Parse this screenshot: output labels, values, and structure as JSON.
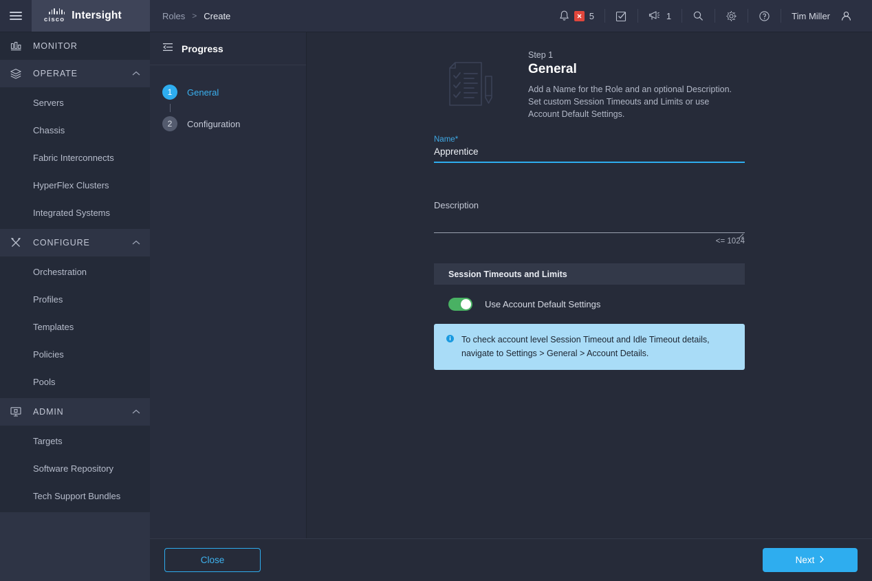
{
  "header": {
    "menu_icon": "hamburger-icon",
    "brand_mark": "cisco-logo",
    "brand_word": "cisco",
    "product": "Intersight",
    "breadcrumb": [
      "Roles",
      "Create"
    ],
    "breadcrumb_separator": ">",
    "alarm_count": "5",
    "announcement_count": "1",
    "user": "Tim Miller",
    "icons": [
      "bell-icon",
      "alarm-badge-icon",
      "task-check-icon",
      "megaphone-icon",
      "search-icon",
      "gear-icon",
      "help-icon",
      "user-avatar-icon"
    ]
  },
  "sidebar": {
    "groups": [
      {
        "label": "MONITOR",
        "icon": "bar-chart-icon",
        "expandable": false,
        "items": []
      },
      {
        "label": "OPERATE",
        "icon": "layers-icon",
        "expandable": true,
        "items": [
          "Servers",
          "Chassis",
          "Fabric Interconnects",
          "HyperFlex Clusters",
          "Integrated Systems"
        ]
      },
      {
        "label": "CONFIGURE",
        "icon": "tools-icon",
        "expandable": true,
        "items": [
          "Orchestration",
          "Profiles",
          "Templates",
          "Policies",
          "Pools"
        ]
      },
      {
        "label": "ADMIN",
        "icon": "admin-monitor-icon",
        "expandable": true,
        "items": [
          "Targets",
          "Software Repository",
          "Tech Support Bundles"
        ]
      }
    ]
  },
  "progress": {
    "collapse_icon": "collapse-panel-icon",
    "title": "Progress",
    "steps": [
      {
        "number": "1",
        "label": "General",
        "state": "active"
      },
      {
        "number": "2",
        "label": "Configuration",
        "state": "inactive"
      }
    ]
  },
  "main": {
    "illustration": "checklist-document-pencil-icon",
    "eyebrow": "Step 1",
    "title": "General",
    "description": "Add a Name for the Role and an optional Description. Set custom Session Timeouts and Limits or use Account Default Settings.",
    "name_field": {
      "label": "Name",
      "required_marker": "*",
      "value": "Apprentice",
      "placeholder": ""
    },
    "description_field": {
      "label": "Description",
      "value": "",
      "placeholder": "",
      "char_limit": "<= 1024"
    },
    "session_section": {
      "title": "Session Timeouts and Limits",
      "toggle_label": "Use Account Default Settings",
      "toggle_state": "on",
      "info_icon": "info-icon",
      "info_text": "To check account level Session Timeout and Idle Timeout details, navigate to Settings > General > Account Details."
    }
  },
  "footer": {
    "close_label": "Close",
    "next_label": "Next",
    "next_icon": "chevron-right-icon"
  },
  "colors": {
    "accent": "#2eadef",
    "toggle_on": "#49b163",
    "alarm": "#e0463c",
    "info_banner": "#a9dcf7",
    "sidebar_bg": "#242a38",
    "group_bg": "#2e3445",
    "main_bg": "#262b39"
  }
}
